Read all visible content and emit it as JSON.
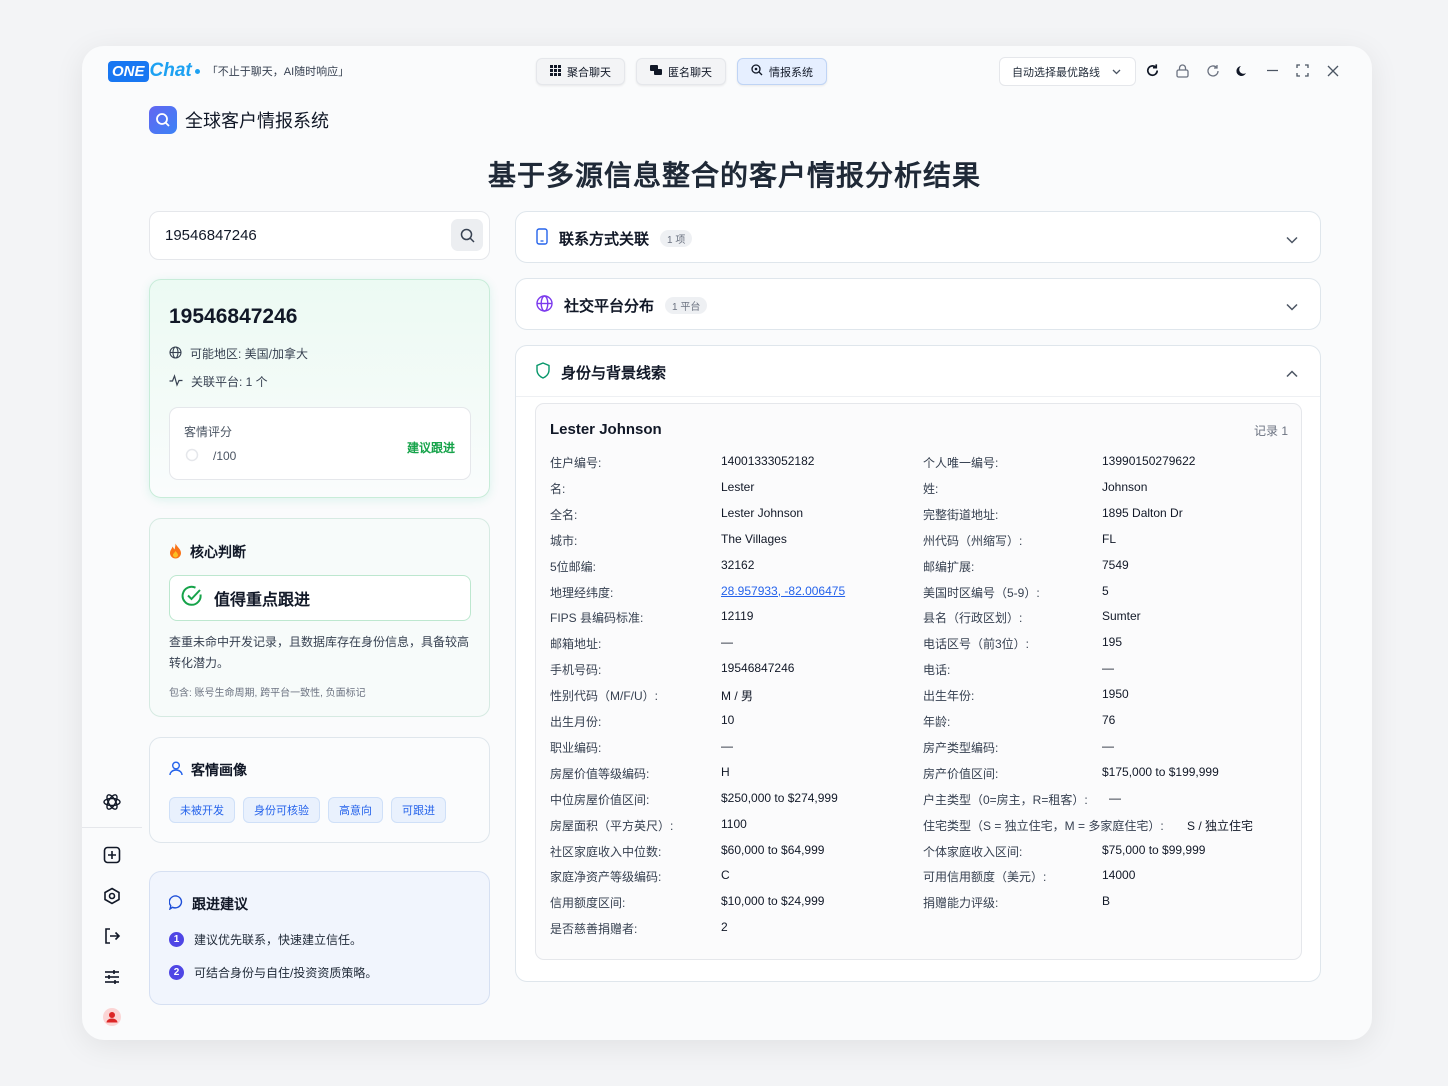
{
  "topbar": {
    "logo_one": "ONE",
    "logo_chat": "Chat",
    "slogan": "「不止于聊天，AI随时响应」",
    "tabs": [
      {
        "label": "聚合聊天",
        "icon": "grid-icon"
      },
      {
        "label": "匿名聊天",
        "icon": "chat-bubbles-icon"
      },
      {
        "label": "情报系统",
        "icon": "search-target-icon"
      }
    ],
    "route_select": "自动选择最优路线"
  },
  "app": {
    "title": "全球客户情报系统"
  },
  "main_title": "基于多源信息整合的客户情报分析结果",
  "search": {
    "value": "19546847246"
  },
  "profile": {
    "number": "19546847246",
    "region": "可能地区: 美国/加拿大",
    "platforms": "关联平台: 1 个",
    "score_label": "客情评分",
    "score_value": "/100",
    "score_action": "建议跟进"
  },
  "core": {
    "title": "核心判断",
    "verdict": "值得重点跟进",
    "desc": "查重未命中开发记录，且数据库存在身份信息，具备较高转化潜力。",
    "note": "包含: 账号生命周期, 跨平台一致性, 负面标记"
  },
  "portrait": {
    "title": "客情画像",
    "tags": [
      "未被开发",
      "身份可核验",
      "高意向",
      "可跟进"
    ]
  },
  "followup": {
    "title": "跟进建议",
    "items": [
      {
        "num": "1",
        "text": "建议优先联系，快速建立信任。"
      },
      {
        "num": "2",
        "text": "可结合身份与自住/投资资质策略。"
      }
    ]
  },
  "sections": [
    {
      "title": "联系方式关联",
      "badge": "1 项"
    },
    {
      "title": "社交平台分布",
      "badge": "1 平台"
    },
    {
      "title": "身份与背景线索",
      "badge": ""
    }
  ],
  "record": {
    "name": "Lester Johnson",
    "index": "记录 1",
    "left": [
      {
        "k": "住户编号:",
        "v": "14001333052182"
      },
      {
        "k": "名:",
        "v": "Lester"
      },
      {
        "k": "全名:",
        "v": "Lester Johnson"
      },
      {
        "k": "城市:",
        "v": "The Villages"
      },
      {
        "k": "5位邮编:",
        "v": "32162"
      },
      {
        "k": "地理经纬度:",
        "v": "28.957933, -82.006475"
      },
      {
        "k": "FIPS 县编码标准:",
        "v": "12119"
      },
      {
        "k": "邮箱地址:",
        "v": "—"
      },
      {
        "k": "手机号码:",
        "v": "19546847246"
      },
      {
        "k": "性别代码（M/F/U）:",
        "v": "M / 男"
      },
      {
        "k": "出生月份:",
        "v": "10"
      },
      {
        "k": "职业编码:",
        "v": "—"
      },
      {
        "k": "房屋价值等级编码:",
        "v": "H"
      },
      {
        "k": "中位房屋价值区间:",
        "v": "$250,000 to $274,999"
      },
      {
        "k": "房屋面积（平方英尺）:",
        "v": "1100"
      },
      {
        "k": "社区家庭收入中位数:",
        "v": "$60,000 to $64,999"
      },
      {
        "k": "家庭净资产等级编码:",
        "v": "C"
      },
      {
        "k": "信用额度区间:",
        "v": "$10,000 to $24,999"
      },
      {
        "k": "是否慈善捐赠者:",
        "v": "2"
      }
    ],
    "right": [
      {
        "k": "个人唯一编号:",
        "v": "13990150279622"
      },
      {
        "k": "姓:",
        "v": "Johnson"
      },
      {
        "k": "完整街道地址:",
        "v": "1895 Dalton Dr"
      },
      {
        "k": "州代码（州缩写）:",
        "v": "FL"
      },
      {
        "k": "邮编扩展:",
        "v": "7549"
      },
      {
        "k": "美国时区编号（5-9）:",
        "v": "5"
      },
      {
        "k": "县名（行政区划）:",
        "v": "Sumter"
      },
      {
        "k": "电话区号（前3位）:",
        "v": "195"
      },
      {
        "k": "电话:",
        "v": "—"
      },
      {
        "k": "出生年份:",
        "v": "1950"
      },
      {
        "k": "年龄:",
        "v": "76"
      },
      {
        "k": "房产类型编码:",
        "v": "—"
      },
      {
        "k": "房产价值区间:",
        "v": "$175,000 to $199,999"
      },
      {
        "k": "户主类型（0=房主，R=租客）:",
        "v": "—"
      },
      {
        "k": "住宅类型（S = 独立住宅，M = 多家庭住宅）:",
        "v": "S / 独立住宅"
      },
      {
        "k": "个体家庭收入区间:",
        "v": "$75,000 to $99,999"
      },
      {
        "k": "可用信用额度（美元）:",
        "v": "14000"
      },
      {
        "k": "捐赠能力评级:",
        "v": "B"
      }
    ]
  },
  "colors": {
    "accent": "#4f46e5",
    "success": "#16a34a",
    "link": "#2563eb"
  }
}
